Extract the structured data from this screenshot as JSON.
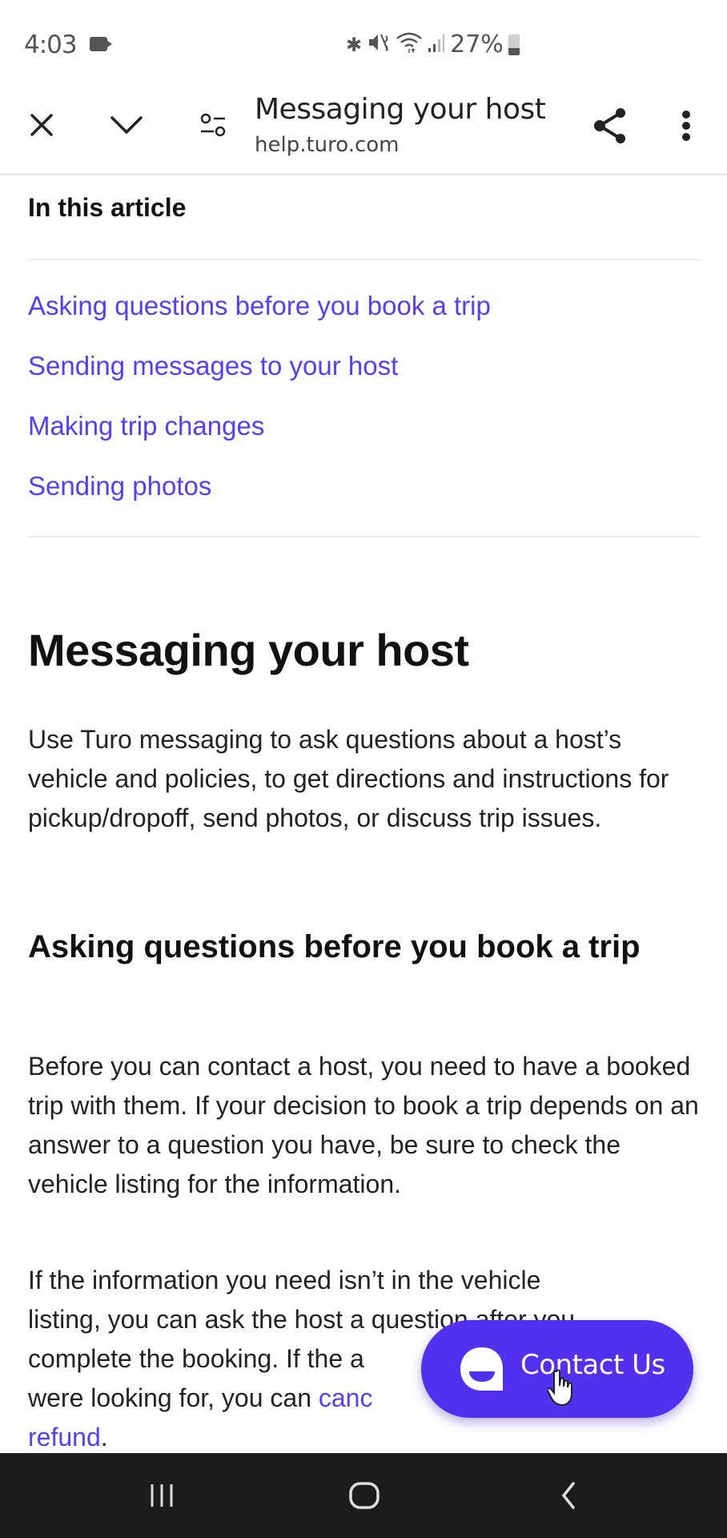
{
  "status_bar": {
    "time": "4:03",
    "battery_percent": "27%",
    "icons": [
      "screen-record-icon",
      "bluetooth-icon",
      "vibrate-mute-icon",
      "wifi-icon",
      "signal-icon",
      "battery-icon"
    ]
  },
  "toolbar": {
    "title": "Messaging your host",
    "url": "help.turo.com",
    "icons": [
      "close-icon",
      "chevron-down-icon",
      "tune-icon",
      "share-icon",
      "more-vert-icon"
    ]
  },
  "toc": {
    "heading": "In this article",
    "links": [
      "Asking questions before you book a trip",
      "Sending messages to your host",
      "Making trip changes",
      "Sending photos"
    ]
  },
  "article": {
    "title": "Messaging your host",
    "intro": "Use Turo messaging to ask questions about a host’s vehicle and policies, to get directions and instructions for pickup/dropoff, send photos, or discuss trip issues.",
    "section1": {
      "heading": "Asking questions before you book a trip",
      "para1": "Before you can contact a host, you need to have a booked trip with them. If your decision to book a trip depends on an answer to a question you have, be sure to check the vehicle listing for the information.",
      "para2_line1": "If the information you need isn’t in the vehicle",
      "para2_line2": "listing, you can ask the host a question after you",
      "para2_line3": "complete the booking. If the a",
      "para2_line4_prefix": "were looking for, you can ",
      "para2_link1": "canc",
      "para2_link2": "refund",
      "para2_end": "."
    }
  },
  "contact_button": {
    "label": "Contact Us",
    "icon": "chat-bubble-icon"
  },
  "nav_bar": {
    "buttons": [
      "recent-apps",
      "home",
      "back"
    ]
  },
  "colors": {
    "link": "#593cfb",
    "button": "#5130f0",
    "text": "#222222",
    "nav_bar": "#1c1c1c"
  }
}
